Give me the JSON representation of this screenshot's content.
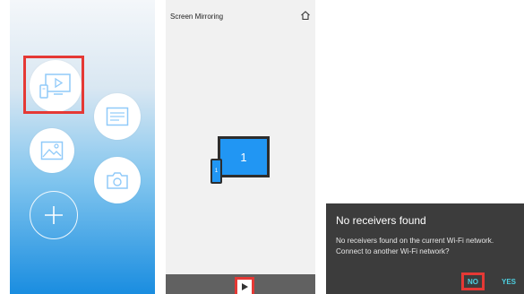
{
  "mirror_screen": {
    "title": "Screen Mirroring",
    "monitor_label": "1",
    "phone_label": "1"
  },
  "dialog": {
    "title": "No receivers found",
    "message": "No receivers found on the current Wi-Fi network. Connect to another Wi-Fi network?",
    "no_label": "NO",
    "yes_label": "YES"
  },
  "icons": {
    "home": [
      "screen-mirroring-icon",
      "document-icon",
      "gallery-icon",
      "camera-icon",
      "add-icon"
    ],
    "mirror": [
      "home-icon",
      "play-icon"
    ]
  },
  "colors": {
    "highlight": "#e53935",
    "accent_blue": "#2196f3",
    "dialog_button": "#4dd0e1",
    "dialog_background": "#3c3c3c",
    "bottom_bar": "#616161"
  }
}
